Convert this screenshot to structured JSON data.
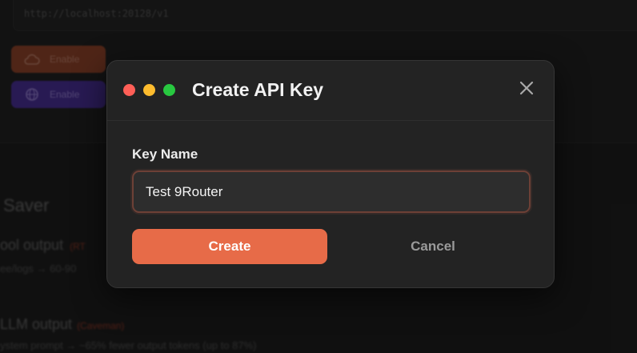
{
  "background": {
    "endpoint_url": "http://localhost:20128/v1",
    "buttons": [
      {
        "label": "Enable",
        "icon": "cloud-icon",
        "color": "#7a3a24"
      },
      {
        "label": "Enable",
        "icon": "globe-icon",
        "color": "#3e2880"
      }
    ],
    "section_heading": "Saver",
    "items": [
      {
        "title": "ool output",
        "tag": "(RT",
        "subtitle": "ee/logs → 60-90"
      },
      {
        "title": "LLM output",
        "tag": "(Caveman)",
        "subtitle": "ystem prompt → ~65% fewer output tokens (up to 87%)"
      }
    ]
  },
  "modal": {
    "title": "Create API Key",
    "window_dots": [
      {
        "name": "close-dot",
        "color": "#ff5f57"
      },
      {
        "name": "minimize-dot",
        "color": "#febc2e"
      },
      {
        "name": "maximize-dot",
        "color": "#28c840"
      }
    ],
    "close_icon": "close-icon",
    "field_label": "Key Name",
    "key_name_value": "Test 9Router",
    "create_label": "Create",
    "cancel_label": "Cancel",
    "accent_color": "#e76b48"
  }
}
